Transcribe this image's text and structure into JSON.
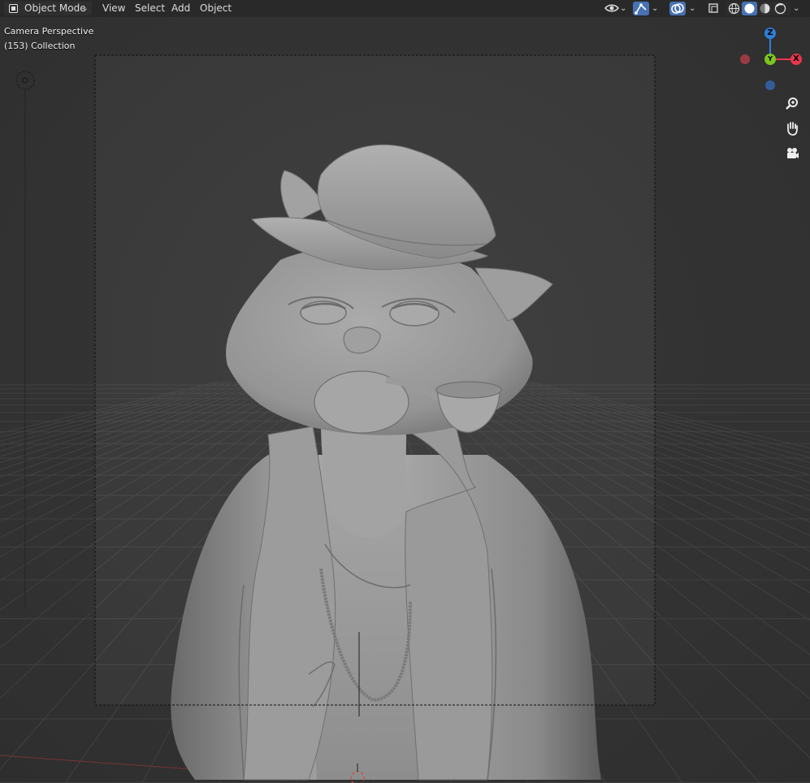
{
  "header": {
    "mode_label": "Object Mode",
    "menus": [
      {
        "id": "view",
        "label": "View"
      },
      {
        "id": "select",
        "label": "Select"
      },
      {
        "id": "add",
        "label": "Add"
      },
      {
        "id": "object",
        "label": "Object"
      }
    ]
  },
  "overlay": {
    "line1": "Camera Perspective",
    "line2": "(153) Collection"
  },
  "gizmo": {
    "z_label": "Z",
    "x_label": "X",
    "y_label": "Y",
    "z_color": "#2d7fd9",
    "x_color": "#e8374d",
    "y_color": "#7ac51f",
    "neg_x_color": "#9b3a45",
    "neg_z_color": "#335d9a"
  },
  "icons": {
    "visibility": "eye-icon",
    "gizmo_toggle": "gizmo-icon",
    "overlays": "overlay-icon",
    "xray": "xray-icon",
    "shading": [
      "wireframe-shading-icon",
      "solid-shading-icon",
      "material-shading-icon",
      "rendered-shading-icon"
    ],
    "nav": [
      "zoom-icon",
      "hand-pan-icon",
      "camera-icon"
    ]
  },
  "colors": {
    "header_active": "#4772b3",
    "viewport_bg": "#3a3a3a"
  }
}
